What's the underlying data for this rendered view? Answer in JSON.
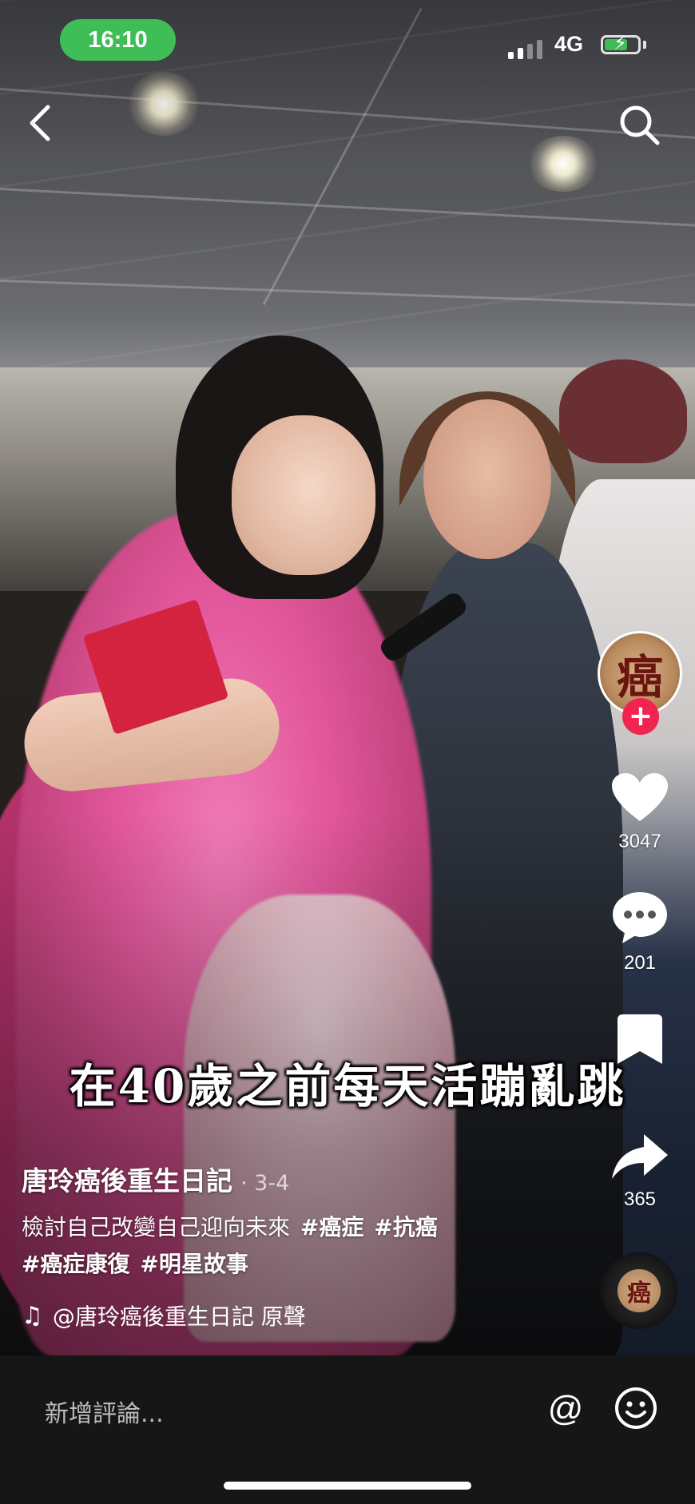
{
  "status_bar": {
    "time": "16:10",
    "network": "4G",
    "battery_level": 0.7
  },
  "nav": {
    "back_icon": "chevron-left-icon",
    "search_icon": "search-icon"
  },
  "video": {
    "overlay_caption": "在40歲之前每天活蹦亂跳"
  },
  "rail": {
    "avatar_text": "癌",
    "follow_icon": "plus-icon",
    "like_count": "3047",
    "comment_count": "201",
    "bookmark_icon": "bookmark-icon",
    "share_count": "365",
    "music_disc_text": "癌"
  },
  "post": {
    "author": "唐玲癌後重生日記",
    "date": "· 3-4",
    "description": "檢討自己改變自己迎向未來",
    "hashtags": [
      "#癌症",
      "#抗癌",
      "#癌症康復",
      "#明星故事"
    ],
    "music": "@唐玲癌後重生日記 原聲"
  },
  "comment_bar": {
    "placeholder": "新增評論...",
    "mention_symbol": "@"
  },
  "colors": {
    "follow_red": "#f0244e",
    "status_green": "#3fbd57",
    "bar_background": "#161616"
  }
}
